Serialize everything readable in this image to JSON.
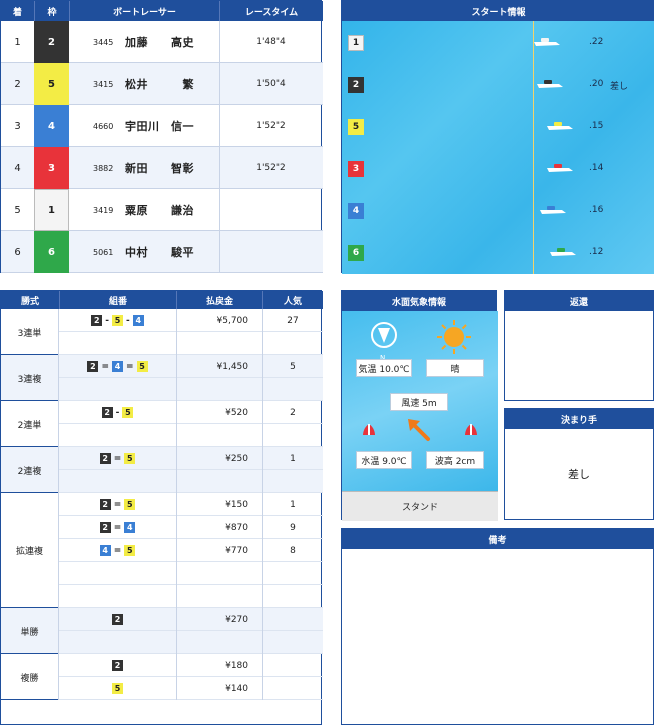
{
  "result": {
    "headers": [
      "着",
      "枠",
      "ボートレーサー",
      "レースタイム"
    ],
    "rows": [
      {
        "pos": "1",
        "frame": "2",
        "reg": "3445",
        "name": "加藤　　高史",
        "time": "1'48\"4"
      },
      {
        "pos": "2",
        "frame": "5",
        "reg": "3415",
        "name": "松井　　　繁",
        "time": "1'50\"4"
      },
      {
        "pos": "3",
        "frame": "4",
        "reg": "4660",
        "name": "宇田川　信一",
        "time": "1'52\"2"
      },
      {
        "pos": "4",
        "frame": "3",
        "reg": "3882",
        "name": "新田　　智彰",
        "time": "1'52\"2"
      },
      {
        "pos": "5",
        "frame": "1",
        "reg": "3419",
        "name": "粟原　　謙治",
        "time": ""
      },
      {
        "pos": "6",
        "frame": "6",
        "reg": "5061",
        "name": "中村　　駿平",
        "time": ""
      }
    ]
  },
  "start": {
    "title": "スタート情報",
    "rows": [
      {
        "boat": "1",
        "time": ".22",
        "note": "",
        "pos": 0.78
      },
      {
        "boat": "2",
        "time": ".20",
        "note": "差し",
        "pos": 0.79
      },
      {
        "boat": "5",
        "time": ".15",
        "note": "",
        "pos": 0.82
      },
      {
        "boat": "3",
        "time": ".14",
        "note": "",
        "pos": 0.82
      },
      {
        "boat": "4",
        "time": ".16",
        "note": "",
        "pos": 0.8
      },
      {
        "boat": "6",
        "time": ".12",
        "note": "",
        "pos": 0.83
      }
    ]
  },
  "payout": {
    "headers": [
      "勝式",
      "組番",
      "払戻金",
      "人気"
    ],
    "groups": [
      {
        "type": "3連単",
        "lines": [
          {
            "combo": [
              "2",
              "-",
              "5",
              "-",
              "4"
            ],
            "amount": "¥5,700",
            "pop": "27"
          },
          {
            "combo": [],
            "amount": "",
            "pop": ""
          }
        ]
      },
      {
        "type": "3連複",
        "lines": [
          {
            "combo": [
              "2",
              "=",
              "4",
              "=",
              "5"
            ],
            "amount": "¥1,450",
            "pop": "5"
          },
          {
            "combo": [],
            "amount": "",
            "pop": ""
          }
        ]
      },
      {
        "type": "2連単",
        "lines": [
          {
            "combo": [
              "2",
              "-",
              "5"
            ],
            "amount": "¥520",
            "pop": "2"
          },
          {
            "combo": [],
            "amount": "",
            "pop": ""
          }
        ]
      },
      {
        "type": "2連複",
        "lines": [
          {
            "combo": [
              "2",
              "=",
              "5"
            ],
            "amount": "¥250",
            "pop": "1"
          },
          {
            "combo": [],
            "amount": "",
            "pop": ""
          }
        ]
      },
      {
        "type": "拡連複",
        "lines": [
          {
            "combo": [
              "2",
              "=",
              "5"
            ],
            "amount": "¥150",
            "pop": "1"
          },
          {
            "combo": [
              "2",
              "=",
              "4"
            ],
            "amount": "¥870",
            "pop": "9"
          },
          {
            "combo": [
              "4",
              "=",
              "5"
            ],
            "amount": "¥770",
            "pop": "8"
          },
          {
            "combo": [],
            "amount": "",
            "pop": ""
          },
          {
            "combo": [],
            "amount": "",
            "pop": ""
          }
        ]
      },
      {
        "type": "単勝",
        "lines": [
          {
            "combo": [
              "2"
            ],
            "amount": "¥270",
            "pop": ""
          },
          {
            "combo": [],
            "amount": "",
            "pop": ""
          }
        ]
      },
      {
        "type": "複勝",
        "lines": [
          {
            "combo": [
              "2"
            ],
            "amount": "¥180",
            "pop": ""
          },
          {
            "combo": [
              "5"
            ],
            "amount": "¥140",
            "pop": ""
          }
        ]
      }
    ]
  },
  "weather": {
    "title": "水面気象情報",
    "compass_label": "N",
    "temp": "気温 10.0℃",
    "condition": "晴",
    "wind": "風速 5m",
    "water_temp": "水温 9.0℃",
    "wave": "波高 2cm",
    "stand": "スタンド"
  },
  "henkan": {
    "title": "返還",
    "value": ""
  },
  "kimarite": {
    "title": "決まり手",
    "value": "差し"
  },
  "biko": {
    "title": "備考",
    "value": ""
  },
  "colors": {
    "header": "#1f4f9c",
    "frame1": "#f4f4f4",
    "frame2": "#333333",
    "frame3": "#e8333a",
    "frame4": "#3a7fd4",
    "frame5": "#f3ec45",
    "frame6": "#2fa84a"
  }
}
